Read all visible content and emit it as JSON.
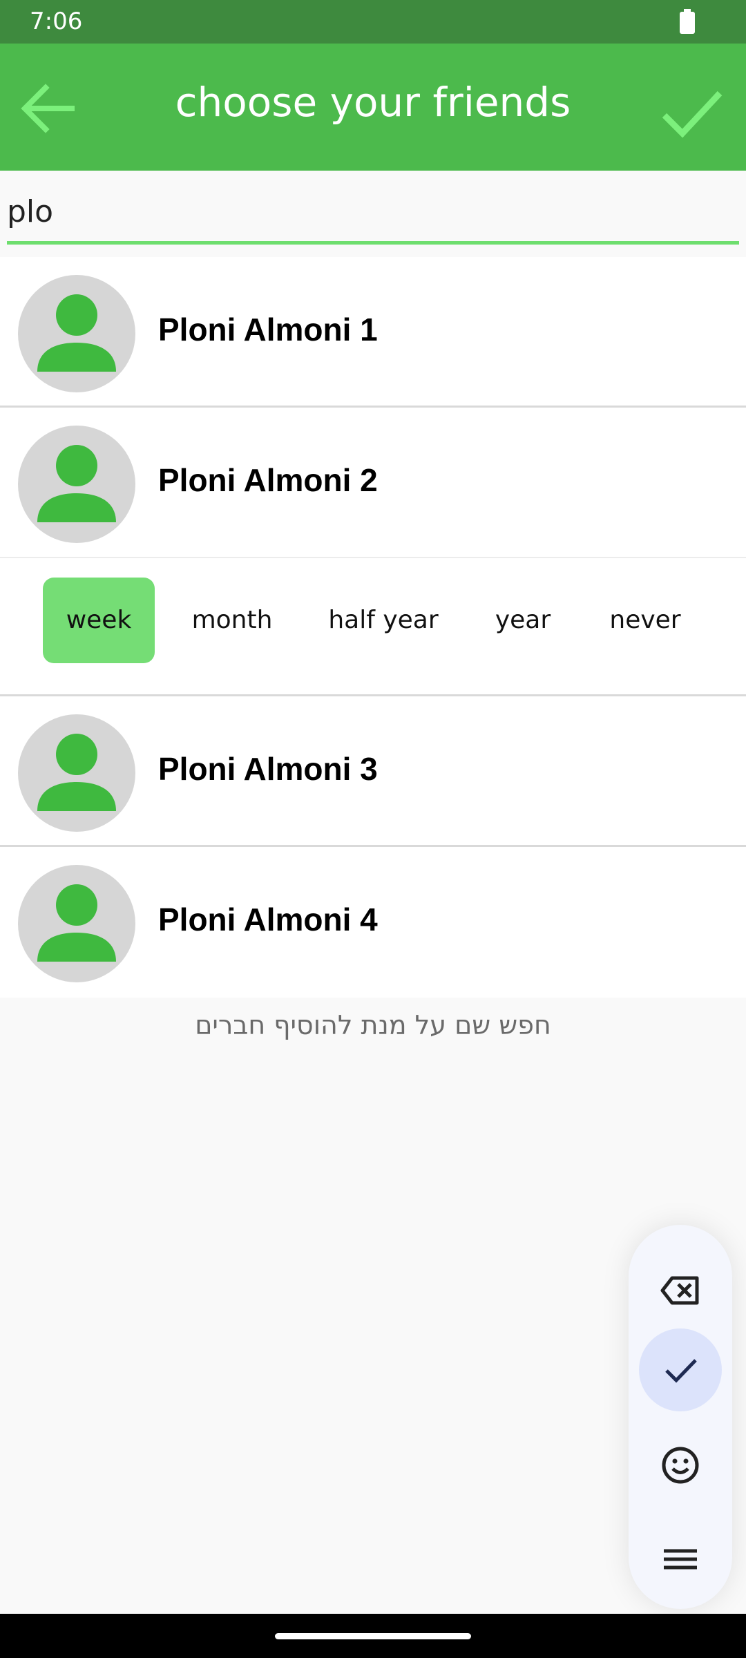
{
  "status_bar": {
    "time": "7:06",
    "battery_icon": "battery-full-icon"
  },
  "app_bar": {
    "title": "choose your friends",
    "back_icon": "arrow-left-icon",
    "confirm_icon": "checkmark-icon"
  },
  "search": {
    "value": "plo",
    "placeholder": ""
  },
  "friends": [
    {
      "name": "Ploni Almoni 1",
      "avatar_icon": "person-avatar-icon"
    },
    {
      "name": "Ploni Almoni 2",
      "avatar_icon": "person-avatar-icon",
      "expanded": true
    },
    {
      "name": "Ploni Almoni 3",
      "avatar_icon": "person-avatar-icon"
    },
    {
      "name": "Ploni Almoni 4",
      "avatar_icon": "person-avatar-icon"
    }
  ],
  "period_options": {
    "items": [
      "week",
      "month",
      "half year",
      "year",
      "never"
    ],
    "selected": "week"
  },
  "hint": "חפש שם על מנת להוסיף חברים",
  "keyboard_toolbar": {
    "buttons": [
      "backspace-icon",
      "check-icon",
      "emoji-icon",
      "menu-icon"
    ],
    "active": "check-icon"
  },
  "colors": {
    "app_bar": "#4cba4c",
    "status_bar": "#3e8a3e",
    "accent_light": "#6ede6e",
    "selected_option": "#75dd75",
    "avatar_figure": "#3fb93f"
  }
}
